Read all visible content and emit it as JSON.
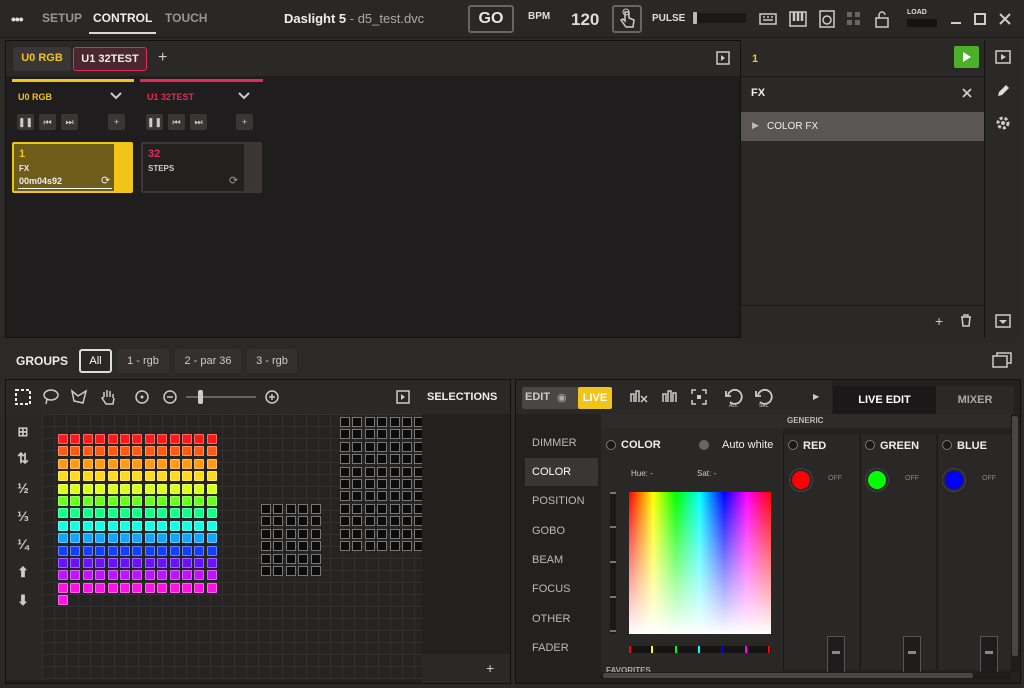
{
  "topbar": {
    "menu_icon": "more-dots-icon",
    "tabs": [
      {
        "label": "SETUP"
      },
      {
        "label": "CONTROL"
      },
      {
        "label": "TOUCH"
      }
    ],
    "active_tab": "CONTROL",
    "title": "Daslight 5",
    "title_sep": " - ",
    "filename": "d5_test.dvc",
    "go_label": "GO",
    "bpm_label": "BPM",
    "bpm_value": "120",
    "pulse_label": "PULSE",
    "load_label": "LOAD"
  },
  "universes": {
    "tabs": [
      {
        "label": "U0 RGB"
      },
      {
        "label": "U1 32TEST"
      }
    ],
    "columns": [
      {
        "name": "U0 RGB",
        "color": "#f0c419",
        "cue": {
          "number": "1",
          "name": "FX",
          "time": "00m04s92"
        }
      },
      {
        "name": "U1 32TEST",
        "color": "#e8285a",
        "cue": {
          "number": "32",
          "name": "STEPS"
        }
      }
    ]
  },
  "sidebar": {
    "scene_number": "1",
    "section": "FX",
    "items": [
      {
        "label": "COLOR FX"
      }
    ]
  },
  "groups": {
    "title": "GROUPS",
    "items": [
      {
        "label": "All"
      },
      {
        "label": "1 - rgb"
      },
      {
        "label": "2 - par 36"
      },
      {
        "label": "3 - rgb"
      }
    ],
    "active": "All"
  },
  "selections": {
    "title": "SELECTIONS"
  },
  "programmer": {
    "mode_edit": "EDIT",
    "mode_live": "LIVE",
    "tab_live_edit": "LIVE EDIT",
    "tab_mixer": "MIXER",
    "generic_label": "GENERIC",
    "attributes": [
      {
        "label": "DIMMER"
      },
      {
        "label": "COLOR"
      },
      {
        "label": "POSITION"
      },
      {
        "label": "GOBO"
      },
      {
        "label": "BEAM"
      },
      {
        "label": "FOCUS"
      },
      {
        "label": "OTHER"
      },
      {
        "label": "FADER"
      }
    ],
    "active_attribute": "COLOR",
    "color_label": "COLOR",
    "auto_white_label": "Auto white",
    "hue_label": "Hue: -",
    "sat_label": "Sat: -",
    "favorites_label": "FAVORITES",
    "channels": [
      {
        "label": "RED",
        "color": "#ff0000",
        "state": "OFF"
      },
      {
        "label": "GREEN",
        "color": "#00ff00",
        "state": "OFF"
      },
      {
        "label": "BLUE",
        "color": "#0000ff",
        "state": "OFF"
      }
    ]
  }
}
